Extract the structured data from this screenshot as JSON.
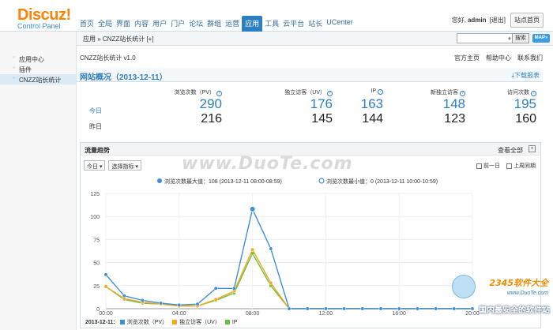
{
  "logo": {
    "name": "Discuz!",
    "subtitle": "Control Panel"
  },
  "topnav": [
    "首页",
    "全局",
    "界面",
    "内容",
    "用户",
    "门户",
    "论坛",
    "群组",
    "运营",
    "应用",
    "工具",
    "云平台",
    "站长",
    "UCenter"
  ],
  "topnav_active": "应用",
  "user": {
    "greeting": "您好,",
    "name": "admin",
    "logout": "[退出]",
    "home": "站点首页"
  },
  "breadcrumb": "应用 » CNZZ站长统计 [+]",
  "search": {
    "button": "搜索",
    "map": "MAP»"
  },
  "sidebar": {
    "items": [
      {
        "label": "应用中心",
        "active": false
      },
      {
        "label": "插件",
        "active": false
      },
      {
        "label": "CNZZ站长统计",
        "active": true
      }
    ]
  },
  "plugin": {
    "title": "CNZZ站长统计 v1.0",
    "links": [
      "官方主页",
      "帮助中心",
      "联系我们"
    ]
  },
  "overview": {
    "title": "网站概况（2013-12-11）",
    "download": "下载报表"
  },
  "stats": {
    "row_today": "今日",
    "row_yesterday": "昨日",
    "columns": [
      {
        "label": "浏览次数（PV）",
        "today": "290",
        "yesterday": "216"
      },
      {
        "label": "独立访客（UV）",
        "today": "176",
        "yesterday": "145"
      },
      {
        "label": "IP",
        "today": "163",
        "yesterday": "144"
      },
      {
        "label": "新独立访客",
        "today": "148",
        "yesterday": "123"
      },
      {
        "label": "访问次数",
        "today": "195",
        "yesterday": "160"
      }
    ]
  },
  "trend": {
    "title": "流量趋势",
    "view_all": "查看全部",
    "controls": [
      "今日 ▾",
      "选择指标 ▾"
    ],
    "compare": [
      "前一日",
      "上周同期"
    ],
    "max_note": "浏览次数最大值：108 (2013-12-11 08:00-08:59)",
    "min_note": "浏览次数最小值：0 (2013-12-11 10:00-10:59)",
    "legend_date": "2013-12-11:",
    "legend": [
      {
        "name": "浏览次数（PV）",
        "color": "#3d8fd6"
      },
      {
        "name": "独立访客（UV）",
        "color": "#f5a623"
      },
      {
        "name": "IP",
        "color": "#6cbf3a"
      }
    ]
  },
  "chart_data": {
    "type": "line",
    "x": [
      "00:00",
      "01:00",
      "02:00",
      "03:00",
      "04:00",
      "05:00",
      "06:00",
      "07:00",
      "08:00",
      "09:00",
      "10:00",
      "11:00",
      "12:00",
      "13:00",
      "14:00",
      "15:00",
      "16:00",
      "17:00",
      "18:00",
      "19:00",
      "20:00"
    ],
    "x_ticks": [
      "00:00",
      "04:00",
      "08:00",
      "12:00",
      "16:00",
      "20:00"
    ],
    "ylim": [
      0,
      125
    ],
    "y_ticks": [
      0,
      25,
      50,
      75,
      100,
      125
    ],
    "series": [
      {
        "name": "浏览次数（PV）",
        "color": "#3d8fd6",
        "values": [
          37,
          14,
          9,
          6,
          4,
          5,
          22,
          22,
          108,
          65,
          0,
          0,
          0,
          0,
          0,
          0,
          0,
          0,
          0,
          0,
          0
        ]
      },
      {
        "name": "独立访客（UV）",
        "color": "#f5a623",
        "values": [
          24,
          11,
          7,
          5,
          3,
          3,
          10,
          19,
          64,
          28,
          0,
          0,
          0,
          0,
          0,
          0,
          0,
          0,
          0,
          0,
          0
        ]
      },
      {
        "name": "IP",
        "color": "#6cbf3a",
        "values": [
          24,
          10,
          6,
          5,
          3,
          3,
          9,
          17,
          60,
          25,
          0,
          0,
          0,
          0,
          0,
          0,
          0,
          0,
          0,
          0,
          0
        ]
      }
    ]
  },
  "watermark": "www.DuoTe.com",
  "corner": {
    "brand": "2345软件大全",
    "site": "www.DuoTe.com",
    "slogan": "国内最安全的软件站"
  }
}
